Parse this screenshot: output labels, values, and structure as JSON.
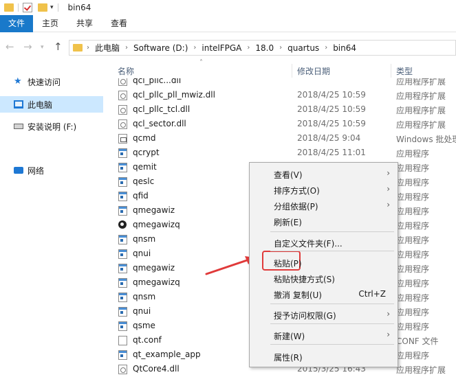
{
  "window": {
    "title": "bin64"
  },
  "ribbon": {
    "tabs": [
      "文件",
      "主页",
      "共享",
      "查看"
    ]
  },
  "address": {
    "crumbs": [
      "此电脑",
      "Software (D:)",
      "intelFPGA",
      "18.0",
      "quartus",
      "bin64"
    ]
  },
  "nav_pane": {
    "items": [
      {
        "label": "快速访问",
        "icon": "star-icon"
      },
      {
        "label": "此电脑",
        "icon": "pc-icon"
      },
      {
        "label": "安装说明 (F:)",
        "icon": "drive-icon"
      },
      {
        "label": "网络",
        "icon": "network-icon"
      }
    ]
  },
  "columns": {
    "name": "名称",
    "date": "修改日期",
    "type": "类型"
  },
  "files": [
    {
      "name": "qcl_plic...dll",
      "date": "",
      "type": "应用程序扩展",
      "icon": "dll-icon"
    },
    {
      "name": "qcl_pllc_pll_mwiz.dll",
      "date": "2018/4/25 10:59",
      "type": "应用程序扩展",
      "icon": "dll-icon"
    },
    {
      "name": "qcl_pllc_tcl.dll",
      "date": "2018/4/25 10:59",
      "type": "应用程序扩展",
      "icon": "dll-icon"
    },
    {
      "name": "qcl_sector.dll",
      "date": "2018/4/25 10:59",
      "type": "应用程序扩展",
      "icon": "dll-icon"
    },
    {
      "name": "qcmd",
      "date": "2018/4/25 9:04",
      "type": "Windows 批处理",
      "icon": "cmd-icon"
    },
    {
      "name": "qcrypt",
      "date": "2018/4/25 11:01",
      "type": "应用程序",
      "icon": "exe-icon"
    },
    {
      "name": "qemit",
      "date": "",
      "type": "应用程序",
      "icon": "exe-icon"
    },
    {
      "name": "qeslc",
      "date": "",
      "type": "应用程序",
      "icon": "exe-icon"
    },
    {
      "name": "qfid",
      "date": "",
      "type": "应用程序",
      "icon": "exe-icon"
    },
    {
      "name": "qmegawiz",
      "date": "",
      "type": "应用程序",
      "icon": "exe-icon"
    },
    {
      "name": "qmegawizq",
      "date": "",
      "type": "应用程序",
      "icon": "wizard-icon"
    },
    {
      "name": "qnsm",
      "date": "",
      "type": "应用程序",
      "icon": "exe-icon"
    },
    {
      "name": "qnui",
      "date": "",
      "type": "应用程序",
      "icon": "exe-icon"
    },
    {
      "name": "qmegawiz",
      "date": "",
      "type": "应用程序",
      "icon": "exe-icon"
    },
    {
      "name": "qmegawizq",
      "date": "",
      "type": "应用程序",
      "icon": "exe-icon"
    },
    {
      "name": "qnsm",
      "date": "",
      "type": "应用程序",
      "icon": "exe-icon"
    },
    {
      "name": "qnui",
      "date": "",
      "type": "应用程序",
      "icon": "exe-icon"
    },
    {
      "name": "qsme",
      "date": "",
      "type": "应用程序",
      "icon": "exe-icon"
    },
    {
      "name": "qt.conf",
      "date": "",
      "type": "CONF 文件",
      "icon": "conf-icon"
    },
    {
      "name": "qt_example_app",
      "date": "",
      "type": "应用程序",
      "icon": "exe-icon"
    },
    {
      "name": "QtCore4.dll",
      "date": "2015/3/25 16:43",
      "type": "应用程序扩展",
      "icon": "dll-icon"
    }
  ],
  "context_menu": {
    "items": [
      {
        "label": "查看(V)",
        "shortcut": "",
        "submenu": true
      },
      {
        "label": "排序方式(O)",
        "shortcut": "",
        "submenu": true
      },
      {
        "label": "分组依据(P)",
        "shortcut": "",
        "submenu": true
      },
      {
        "label": "刷新(E)",
        "shortcut": "",
        "submenu": false
      },
      {
        "label": "自定义文件夹(F)...",
        "shortcut": "",
        "submenu": false
      },
      {
        "label": "粘贴(P)",
        "shortcut": "",
        "submenu": false
      },
      {
        "label": "粘贴快捷方式(S)",
        "shortcut": "",
        "submenu": false
      },
      {
        "label": "撤消 复制(U)",
        "shortcut": "Ctrl+Z",
        "submenu": false
      },
      {
        "label": "授予访问权限(G)",
        "shortcut": "",
        "submenu": true
      },
      {
        "label": "新建(W)",
        "shortcut": "",
        "submenu": true
      },
      {
        "label": "属性(R)",
        "shortcut": "",
        "submenu": false
      }
    ]
  },
  "colors": {
    "accent": "#1979ca",
    "selected_bg": "#cce8ff",
    "annotation": "#e03a3a"
  }
}
